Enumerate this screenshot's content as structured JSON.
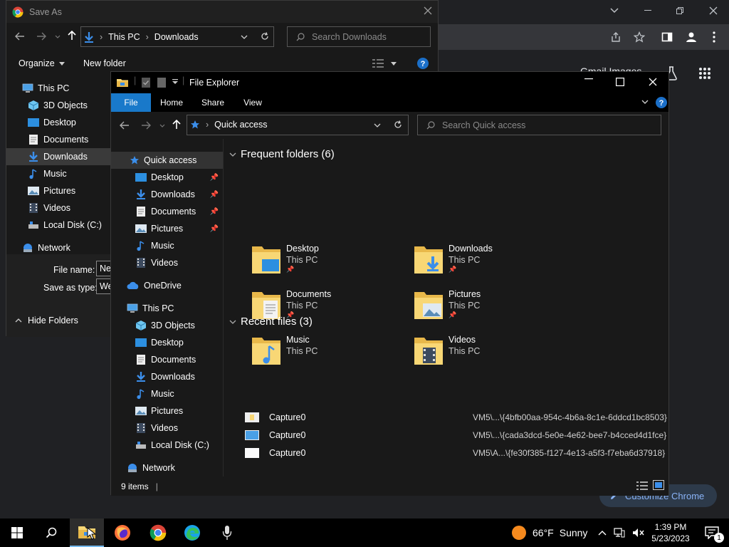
{
  "chrome": {
    "gmail_text": "Gmail Images",
    "customize_label": "Customize Chrome"
  },
  "save_as": {
    "title": "Save As",
    "breadcrumb": [
      "This PC",
      "Downloads"
    ],
    "search_placeholder": "Search Downloads",
    "organize_label": "Organize",
    "new_folder_label": "New folder",
    "tree": [
      {
        "label": "This PC",
        "icon": "pc-icon"
      },
      {
        "label": "3D Objects",
        "icon": "3d-objects-icon"
      },
      {
        "label": "Desktop",
        "icon": "desktop-folder-icon"
      },
      {
        "label": "Documents",
        "icon": "documents-folder-icon"
      },
      {
        "label": "Downloads",
        "icon": "downloads-folder-icon"
      },
      {
        "label": "Music",
        "icon": "music-folder-icon"
      },
      {
        "label": "Pictures",
        "icon": "pictures-folder-icon"
      },
      {
        "label": "Videos",
        "icon": "videos-folder-icon"
      },
      {
        "label": "Local Disk (C:)",
        "icon": "disk-icon"
      },
      {
        "label": "Network",
        "icon": "network-icon"
      }
    ],
    "file_name_label": "File name:",
    "file_name_value": "Ne",
    "save_type_label": "Save as type:",
    "save_type_value": "We",
    "hide_folders_label": "Hide Folders"
  },
  "file_explorer": {
    "title": "File Explorer",
    "tabs": [
      "File",
      "Home",
      "Share",
      "View"
    ],
    "address": "Quick access",
    "search_placeholder": "Search Quick access",
    "sidebar": [
      {
        "label": "Quick access",
        "pinned": false
      },
      {
        "label": "Desktop",
        "pinned": true
      },
      {
        "label": "Downloads",
        "pinned": true
      },
      {
        "label": "Documents",
        "pinned": true
      },
      {
        "label": "Pictures",
        "pinned": true
      },
      {
        "label": "Music",
        "pinned": false
      },
      {
        "label": "Videos",
        "pinned": false
      },
      {
        "label": "OneDrive",
        "pinned": false
      },
      {
        "label": "This PC",
        "pinned": false
      },
      {
        "label": "3D Objects",
        "pinned": false
      },
      {
        "label": "Desktop",
        "pinned": false
      },
      {
        "label": "Documents",
        "pinned": false
      },
      {
        "label": "Downloads",
        "pinned": false
      },
      {
        "label": "Music",
        "pinned": false
      },
      {
        "label": "Pictures",
        "pinned": false
      },
      {
        "label": "Videos",
        "pinned": false
      },
      {
        "label": "Local Disk (C:)",
        "pinned": false
      },
      {
        "label": "Network",
        "pinned": false
      }
    ],
    "frequent_header": "Frequent folders (6)",
    "frequent": [
      {
        "name": "Desktop",
        "location": "This PC",
        "pinned": true
      },
      {
        "name": "Downloads",
        "location": "This PC",
        "pinned": true
      },
      {
        "name": "Documents",
        "location": "This PC",
        "pinned": true
      },
      {
        "name": "Pictures",
        "location": "This PC",
        "pinned": true
      },
      {
        "name": "Music",
        "location": "This PC",
        "pinned": false
      },
      {
        "name": "Videos",
        "location": "This PC",
        "pinned": false
      }
    ],
    "recent_header": "Recent files (3)",
    "recent": [
      {
        "name": "Capture0",
        "path": "VM5\\...\\{4bfb00aa-954c-4b6a-8c1e-6ddcd1bc8503}"
      },
      {
        "name": "Capture0",
        "path": "VM5\\...\\{cada3dcd-5e0e-4e62-bee7-b4cced4d1fce}"
      },
      {
        "name": "Capture0",
        "path": "VM5\\A...\\{fe30f385-f127-4e13-a5f3-f7eba6d37918}"
      }
    ],
    "status_items": "9 items"
  },
  "taskbar": {
    "weather_temp": "66°F",
    "weather_desc": "Sunny",
    "time": "1:39 PM",
    "date": "5/23/2023",
    "notification_count": "1"
  },
  "colors": {
    "accent": "#0078d7",
    "folder_yellow": "#f8d775",
    "chrome_bg": "#202124"
  }
}
